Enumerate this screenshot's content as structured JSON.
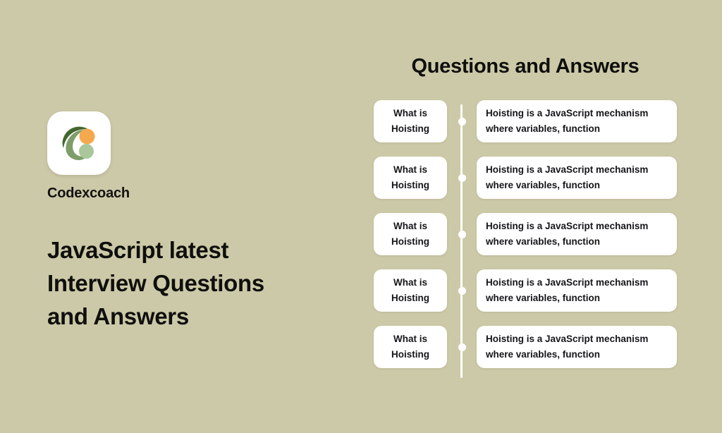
{
  "theme": {
    "background": "#CCC9A8",
    "card_background": "#FFFFFF",
    "text_color": "#16161A",
    "timeline_color": "#FFFFFF",
    "logo_dark_green": "#44662F",
    "logo_mid_green": "#7D9E6B",
    "logo_light_green": "#A9C79A",
    "logo_orange": "#F5A94E"
  },
  "brand": {
    "name": "Codexcoach",
    "logo_icon": "codexcoach-c-logo"
  },
  "main": {
    "title_lines": [
      "JavaScript latest",
      "Interview Questions",
      "and Answers"
    ],
    "title_full": "JavaScript latest Interview Questions and Answers"
  },
  "qa": {
    "heading": "Questions and Answers",
    "rows": [
      {
        "question_lines": [
          "What is",
          "Hoisting"
        ],
        "question": "What is Hoisting",
        "answer_lines": [
          "Hoisting is a JavaScript mechanism",
          "where variables, function"
        ],
        "answer": "Hoisting is a JavaScript mechanism where variables, function"
      },
      {
        "question_lines": [
          "What is",
          "Hoisting"
        ],
        "question": "What is Hoisting",
        "answer_lines": [
          "Hoisting is a JavaScript mechanism",
          "where variables, function"
        ],
        "answer": "Hoisting is a JavaScript mechanism where variables, function"
      },
      {
        "question_lines": [
          "What is",
          "Hoisting"
        ],
        "question": "What is Hoisting",
        "answer_lines": [
          "Hoisting is a JavaScript mechanism",
          "where variables, function"
        ],
        "answer": "Hoisting is a JavaScript mechanism where variables, function"
      },
      {
        "question_lines": [
          "What is",
          "Hoisting"
        ],
        "question": "What is Hoisting",
        "answer_lines": [
          "Hoisting is a JavaScript mechanism",
          "where variables, function"
        ],
        "answer": "Hoisting is a JavaScript mechanism where variables, function"
      },
      {
        "question_lines": [
          "What is",
          "Hoisting"
        ],
        "question": "What is Hoisting",
        "answer_lines": [
          "Hoisting is a JavaScript mechanism",
          "where variables, function"
        ],
        "answer": "Hoisting is a JavaScript mechanism where variables, function"
      }
    ]
  }
}
